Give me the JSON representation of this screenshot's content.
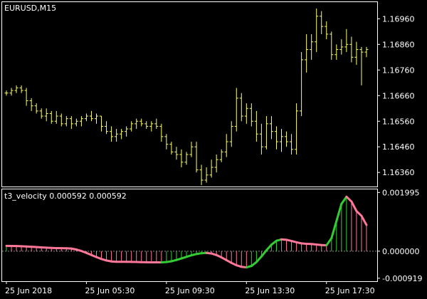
{
  "window": {
    "symbol_title": "EURUSD,M15",
    "indicator_title": "t3_velocity 0.000592 0.000592"
  },
  "colors": {
    "background": "#000000",
    "frame": "#ffffff",
    "bars": "#ffff66",
    "velocity_up": "#33cc33",
    "velocity_down": "#ff7799",
    "histogram_up": "#33cc33",
    "histogram_down": "#ff7799",
    "zero_line": "#888888"
  },
  "chart_data": [
    {
      "type": "ohlc",
      "title": "EURUSD,M15",
      "y_ticks": [
        1.1696,
        1.1686,
        1.1676,
        1.1666,
        1.1656,
        1.1646,
        1.1636
      ],
      "y_tick_labels": [
        "1.16960",
        "1.16860",
        "1.16760",
        "1.16660",
        "1.16560",
        "1.16460",
        "1.16360"
      ],
      "ylim": [
        1.16305,
        1.17025
      ],
      "x_labels": [
        "25 Jun 2018",
        "25 Jun 05:30",
        "25 Jun 09:30",
        "25 Jun 13:30",
        "25 Jun 17:30"
      ],
      "bars": [
        [
          1.1667,
          1.1668,
          1.1666,
          1.1667
        ],
        [
          1.1667,
          1.1669,
          1.1666,
          1.1668
        ],
        [
          1.1668,
          1.167,
          1.1667,
          1.1669
        ],
        [
          1.1669,
          1.167,
          1.1667,
          1.1668
        ],
        [
          1.1668,
          1.1669,
          1.1662,
          1.1664
        ],
        [
          1.1664,
          1.1665,
          1.166,
          1.1662
        ],
        [
          1.1662,
          1.1663,
          1.1659,
          1.166
        ],
        [
          1.166,
          1.1661,
          1.1657,
          1.1658
        ],
        [
          1.1658,
          1.1661,
          1.1656,
          1.1659
        ],
        [
          1.1659,
          1.166,
          1.1655,
          1.1656
        ],
        [
          1.1656,
          1.166,
          1.1655,
          1.1658
        ],
        [
          1.1658,
          1.1659,
          1.1654,
          1.1655
        ],
        [
          1.1655,
          1.1658,
          1.1654,
          1.1657
        ],
        [
          1.1657,
          1.1658,
          1.1653,
          1.1655
        ],
        [
          1.1655,
          1.1657,
          1.1654,
          1.1656
        ],
        [
          1.1656,
          1.1658,
          1.1654,
          1.1657
        ],
        [
          1.1657,
          1.1659,
          1.1656,
          1.1658
        ],
        [
          1.1658,
          1.166,
          1.1656,
          1.1657
        ],
        [
          1.1657,
          1.1659,
          1.1655,
          1.1658
        ],
        [
          1.1658,
          1.1658,
          1.1652,
          1.1654
        ],
        [
          1.1654,
          1.1656,
          1.1651,
          1.1652
        ],
        [
          1.1652,
          1.1654,
          1.1648,
          1.165
        ],
        [
          1.165,
          1.1653,
          1.1648,
          1.1651
        ],
        [
          1.1651,
          1.1653,
          1.1649,
          1.1652
        ],
        [
          1.1652,
          1.1654,
          1.165,
          1.1653
        ],
        [
          1.1653,
          1.1656,
          1.1652,
          1.1655
        ],
        [
          1.1655,
          1.1657,
          1.1653,
          1.1656
        ],
        [
          1.1656,
          1.1657,
          1.1654,
          1.1655
        ],
        [
          1.1655,
          1.1656,
          1.1653,
          1.1654
        ],
        [
          1.1654,
          1.1656,
          1.1652,
          1.1655
        ],
        [
          1.1655,
          1.1657,
          1.1653,
          1.1654
        ],
        [
          1.1654,
          1.1655,
          1.1648,
          1.165
        ],
        [
          1.165,
          1.1651,
          1.1645,
          1.1647
        ],
        [
          1.1647,
          1.1648,
          1.1643,
          1.1644
        ],
        [
          1.1644,
          1.1646,
          1.1641,
          1.1643
        ],
        [
          1.1643,
          1.1645,
          1.1638,
          1.164
        ],
        [
          1.164,
          1.1644,
          1.1639,
          1.1643
        ],
        [
          1.1643,
          1.1648,
          1.1642,
          1.1646
        ],
        [
          1.1646,
          1.1648,
          1.1636,
          1.1637
        ],
        [
          1.1637,
          1.1639,
          1.1631,
          1.1633
        ],
        [
          1.1633,
          1.1638,
          1.1632,
          1.1635
        ],
        [
          1.1635,
          1.1641,
          1.1634,
          1.1638
        ],
        [
          1.1638,
          1.1643,
          1.1636,
          1.1641
        ],
        [
          1.1641,
          1.1645,
          1.164,
          1.1644
        ],
        [
          1.1644,
          1.1651,
          1.1642,
          1.1648
        ],
        [
          1.1648,
          1.1656,
          1.1646,
          1.1654
        ],
        [
          1.1654,
          1.1669,
          1.1652,
          1.1665
        ],
        [
          1.1665,
          1.1667,
          1.1656,
          1.1658
        ],
        [
          1.1658,
          1.1663,
          1.1655,
          1.1661
        ],
        [
          1.1661,
          1.1663,
          1.1654,
          1.1656
        ],
        [
          1.1656,
          1.166,
          1.1648,
          1.1651
        ],
        [
          1.1651,
          1.1655,
          1.1643,
          1.1646
        ],
        [
          1.1646,
          1.1658,
          1.1645,
          1.1655
        ],
        [
          1.1655,
          1.1658,
          1.1649,
          1.1652
        ],
        [
          1.1652,
          1.1654,
          1.1645,
          1.1648
        ],
        [
          1.1648,
          1.1653,
          1.1644,
          1.165
        ],
        [
          1.165,
          1.1652,
          1.1646,
          1.1648
        ],
        [
          1.1648,
          1.1651,
          1.1643,
          1.1645
        ],
        [
          1.1645,
          1.1663,
          1.1643,
          1.166
        ],
        [
          1.166,
          1.1683,
          1.1658,
          1.168
        ],
        [
          1.168,
          1.169,
          1.1675,
          1.1684
        ],
        [
          1.1684,
          1.169,
          1.168,
          1.1687
        ],
        [
          1.1687,
          1.17,
          1.1683,
          1.1697
        ],
        [
          1.1697,
          1.1699,
          1.169,
          1.1693
        ],
        [
          1.1693,
          1.1695,
          1.1688,
          1.169
        ],
        [
          1.169,
          1.1691,
          1.168,
          1.1682
        ],
        [
          1.1682,
          1.1686,
          1.168,
          1.1684
        ],
        [
          1.1684,
          1.1688,
          1.1682,
          1.1685
        ],
        [
          1.1685,
          1.1692,
          1.1683,
          1.1686
        ],
        [
          1.1686,
          1.1689,
          1.1679,
          1.1681
        ],
        [
          1.1681,
          1.1687,
          1.1678,
          1.1684
        ],
        [
          1.1684,
          1.1685,
          1.167,
          1.1683
        ],
        [
          1.1683,
          1.1685,
          1.1681,
          1.1684
        ]
      ]
    },
    {
      "type": "line",
      "title": "t3_velocity 0.000592 0.000592",
      "y_ticks": [
        0.001995,
        0.0,
        -0.000919
      ],
      "y_tick_labels": [
        "0.001995",
        "0.000000",
        "-0.000919"
      ],
      "ylim": [
        -0.00102,
        0.0021
      ],
      "x": [
        0,
        12,
        22,
        31,
        40,
        48,
        55,
        60,
        64,
        68,
        71,
        73
      ],
      "values": [
        0.00018,
        0.0001,
        -0.00036,
        -0.00038,
        -6e-05,
        -0.00055,
        0.0004,
        0.00025,
        0.0002,
        0.00185,
        0.0012,
        0.00058
      ],
      "histogram": true
    }
  ]
}
